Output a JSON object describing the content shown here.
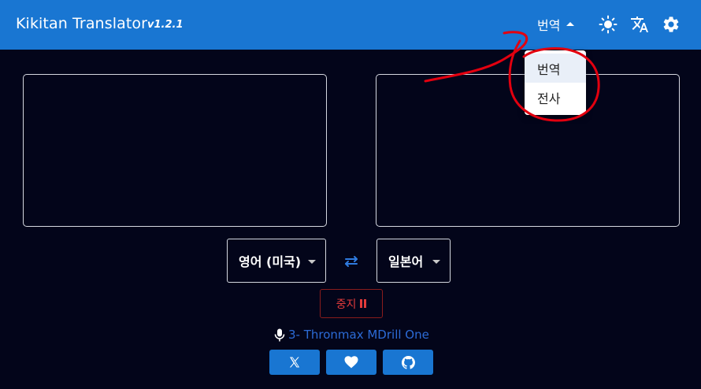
{
  "header": {
    "title": "Kikitan Translator",
    "version": "v1.2.1",
    "mode_label": "번역",
    "icons": [
      "sun-icon",
      "translate-icon",
      "gear-icon"
    ],
    "bg_color": "#1976d2"
  },
  "mode_menu": {
    "items": [
      "번역",
      "전사"
    ],
    "selected": "번역"
  },
  "source_text": {
    "value": ""
  },
  "target_text": {
    "value": ""
  },
  "languages": {
    "source": "영어 (미국)",
    "target": "일본어"
  },
  "controls": {
    "stop_label": "중지",
    "device_label": "3- Thronmax MDrill One"
  },
  "social": [
    "x-icon",
    "heart-icon",
    "github-icon"
  ],
  "colors": {
    "accent": "#1976d2",
    "background": "#03051a",
    "stop": "#e23b3b",
    "device": "#2c6bd6"
  }
}
